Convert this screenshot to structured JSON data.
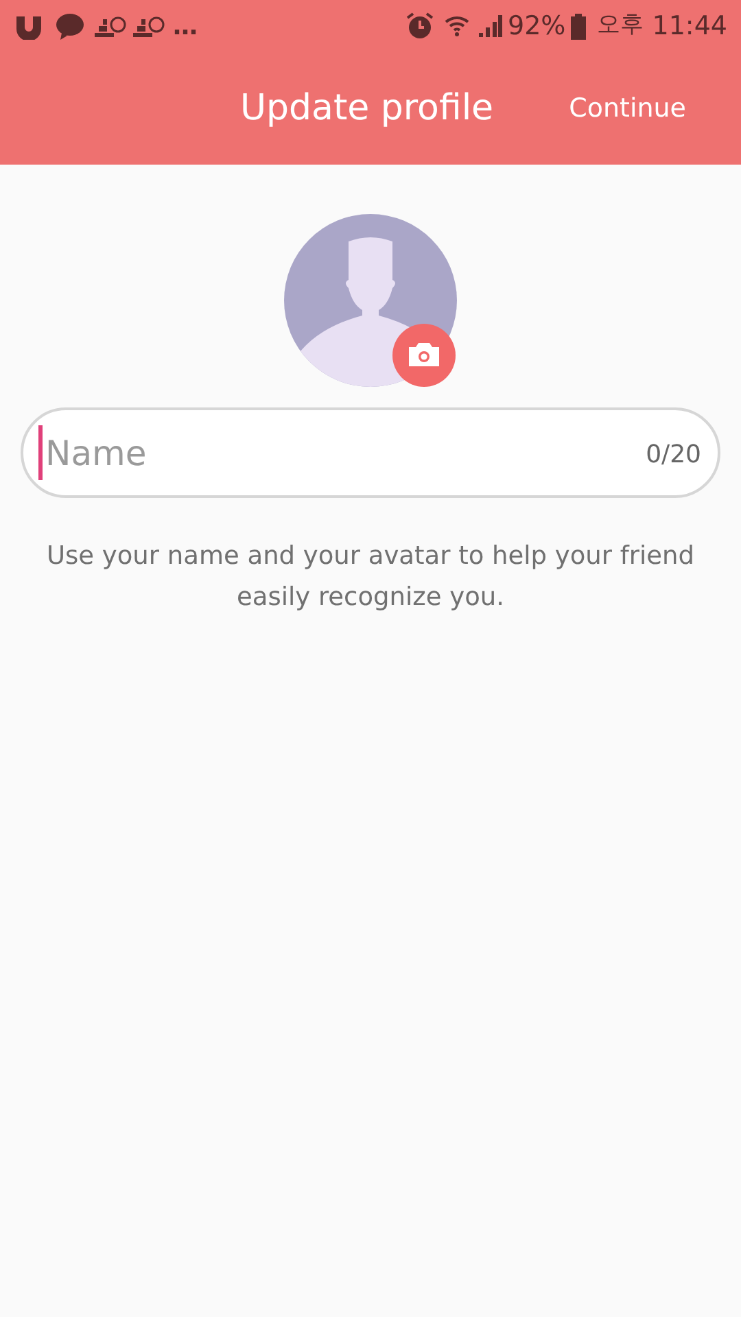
{
  "status_bar": {
    "overflow": "…",
    "battery": "92%",
    "ampm": "오후",
    "time": "11:44"
  },
  "toolbar": {
    "title": "Update profile",
    "action": "Continue"
  },
  "name_field": {
    "placeholder": "Name",
    "counter": "0/20"
  },
  "hint": "Use your name and your avatar to help your friend easily recognize you."
}
